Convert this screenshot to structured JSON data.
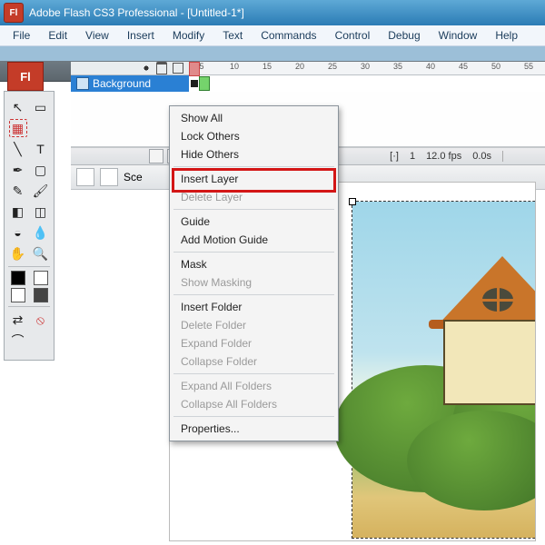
{
  "titlebar": {
    "title": "Adobe Flash CS3 Professional - [Untitled-1*]"
  },
  "menubar": {
    "items": [
      "File",
      "Edit",
      "View",
      "Insert",
      "Modify",
      "Text",
      "Commands",
      "Control",
      "Debug",
      "Window",
      "Help"
    ]
  },
  "tab": {
    "label": "Untitled-1*"
  },
  "flicon": {
    "label": "Fl"
  },
  "layer": {
    "name": "Background"
  },
  "ruler": {
    "ticks": [
      "5",
      "10",
      "15",
      "20",
      "25",
      "30",
      "35",
      "40",
      "45",
      "50",
      "55"
    ]
  },
  "status": {
    "frame": "1",
    "fps": "12.0 fps",
    "time": "0.0s"
  },
  "scene": {
    "label": "Sce"
  },
  "context_menu": {
    "groups": [
      [
        {
          "label": "Show All",
          "enabled": true
        },
        {
          "label": "Lock Others",
          "enabled": true
        },
        {
          "label": "Hide Others",
          "enabled": true
        }
      ],
      [
        {
          "label": "Insert Layer",
          "enabled": true,
          "highlight": true
        },
        {
          "label": "Delete Layer",
          "enabled": false
        }
      ],
      [
        {
          "label": "Guide",
          "enabled": true
        },
        {
          "label": "Add Motion Guide",
          "enabled": true
        }
      ],
      [
        {
          "label": "Mask",
          "enabled": true
        },
        {
          "label": "Show Masking",
          "enabled": false
        }
      ],
      [
        {
          "label": "Insert Folder",
          "enabled": true
        },
        {
          "label": "Delete Folder",
          "enabled": false
        },
        {
          "label": "Expand Folder",
          "enabled": false
        },
        {
          "label": "Collapse Folder",
          "enabled": false
        }
      ],
      [
        {
          "label": "Expand All Folders",
          "enabled": false
        },
        {
          "label": "Collapse All Folders",
          "enabled": false
        }
      ],
      [
        {
          "label": "Properties...",
          "enabled": true
        }
      ]
    ]
  },
  "tools": {
    "rows": [
      [
        "arrow",
        "subselect"
      ],
      [
        "lasso",
        ""
      ],
      [
        "line",
        "text"
      ],
      [
        "pen",
        "rect"
      ],
      [
        "pencil",
        "brush"
      ],
      [
        "ink",
        "eraser"
      ],
      [
        "paint",
        "eyedrop"
      ],
      [
        "hand",
        "zoom"
      ]
    ]
  }
}
